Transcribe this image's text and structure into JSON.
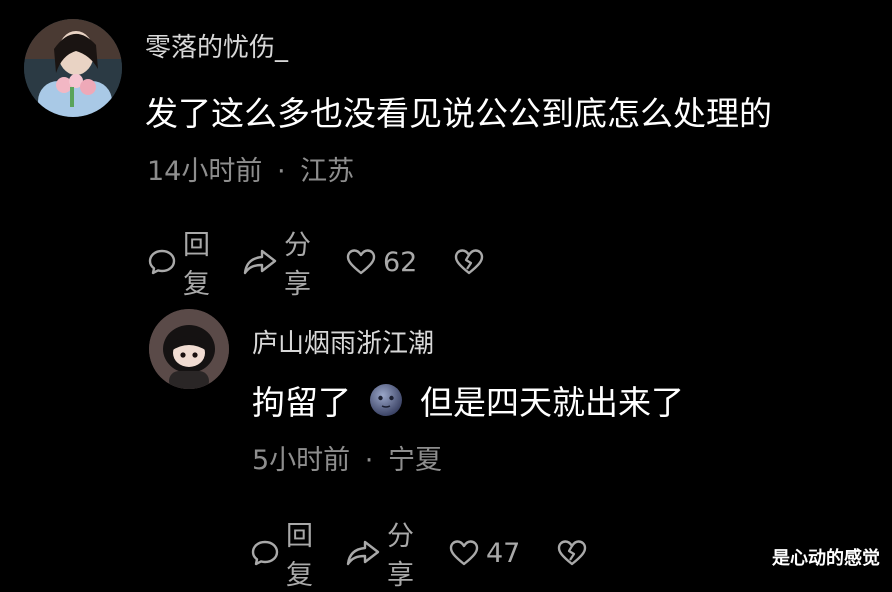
{
  "comments": [
    {
      "username": "零落的忧伤_",
      "text": "发了这么多也没看见说公公到底怎么处理的",
      "time": "14小时前",
      "location": "江苏",
      "reply_label": "回复",
      "share_label": "分享",
      "likes": "62"
    },
    {
      "username": "庐山烟雨浙江潮",
      "text_before": "拘留了",
      "text_after": "但是四天就出来了",
      "emoji": "moon-face-emoji",
      "time": "5小时前",
      "location": "宁夏",
      "reply_label": "回复",
      "share_label": "分享",
      "likes": "47"
    }
  ],
  "watermark": "是心动的感觉",
  "separator": "·",
  "colors": {
    "background": "#000000",
    "username": "#d8d8d8",
    "content": "#ffffff",
    "meta": "#8e8e8e",
    "actions": "#a9a9a9"
  },
  "icons": {
    "reply": "speech-bubble-icon",
    "share": "share-arrow-icon",
    "like": "heart-icon",
    "dislike": "broken-heart-icon"
  }
}
